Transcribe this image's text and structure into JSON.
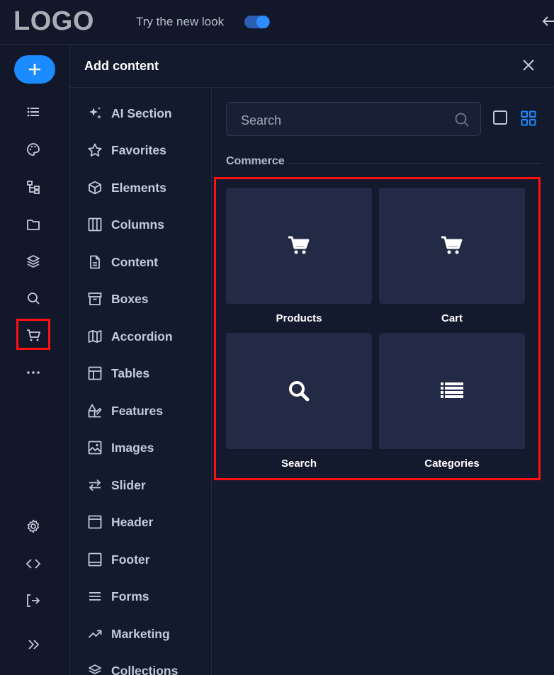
{
  "topbar": {
    "logo": "LOGO",
    "try_label": "Try the new look",
    "toggle_on": true
  },
  "rail": {
    "add_icon": "plus-icon",
    "icons": [
      "list-icon",
      "palette-icon",
      "sitemap-icon",
      "folder-icon",
      "layers-icon",
      "search-icon",
      "cart-icon",
      "more-icon",
      "gear-icon",
      "code-icon",
      "exit-icon",
      "expand-icon"
    ],
    "active": "cart-icon"
  },
  "panel": {
    "title": "Add content"
  },
  "categories": [
    {
      "label": "AI Section",
      "icon": "sparkle-icon"
    },
    {
      "label": "Favorites",
      "icon": "star-icon"
    },
    {
      "label": "Elements",
      "icon": "cube-icon"
    },
    {
      "label": "Columns",
      "icon": "columns-icon"
    },
    {
      "label": "Content",
      "icon": "document-icon"
    },
    {
      "label": "Boxes",
      "icon": "archive-icon"
    },
    {
      "label": "Accordion",
      "icon": "map-icon"
    },
    {
      "label": "Tables",
      "icon": "table-icon"
    },
    {
      "label": "Features",
      "icon": "shapes-icon"
    },
    {
      "label": "Images",
      "icon": "image-icon"
    },
    {
      "label": "Slider",
      "icon": "arrows-icon"
    },
    {
      "label": "Header",
      "icon": "header-icon"
    },
    {
      "label": "Footer",
      "icon": "footer-icon"
    },
    {
      "label": "Forms",
      "icon": "lines-icon"
    },
    {
      "label": "Marketing",
      "icon": "trend-icon"
    },
    {
      "label": "Collections",
      "icon": "stack-icon"
    }
  ],
  "search": {
    "placeholder": "Search"
  },
  "section": {
    "label": "Commerce"
  },
  "tiles": [
    {
      "label": "Products",
      "icon": "cart-icon"
    },
    {
      "label": "Cart",
      "icon": "cart-icon"
    },
    {
      "label": "Search",
      "icon": "magnifier-icon"
    },
    {
      "label": "Categories",
      "icon": "list-icon"
    }
  ],
  "colors": {
    "accent": "#1a8cff",
    "highlight": "#ff1010",
    "background": "#141a2e"
  }
}
